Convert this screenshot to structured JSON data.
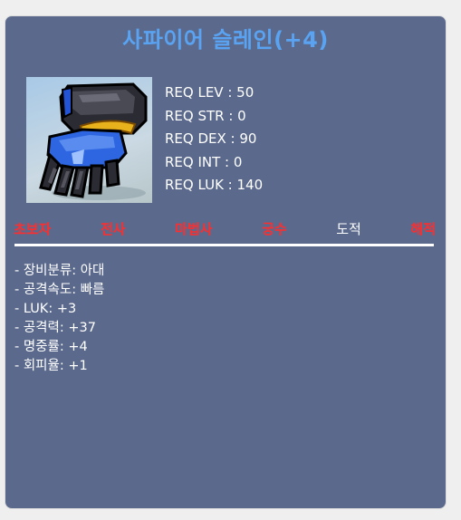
{
  "item": {
    "name": "사파이어 슬레인(+4)",
    "icon": "sapphire-slain-glove-icon"
  },
  "requirements": [
    "REQ LEV : 50",
    "REQ STR : 0",
    "REQ DEX : 90",
    "REQ INT : 0",
    "REQ LUK : 140"
  ],
  "jobs": [
    {
      "label": "초보자",
      "allowed": false
    },
    {
      "label": "전사",
      "allowed": false
    },
    {
      "label": "마법사",
      "allowed": false
    },
    {
      "label": "궁수",
      "allowed": false
    },
    {
      "label": "도적",
      "allowed": true
    },
    {
      "label": "해적",
      "allowed": false
    }
  ],
  "stats": [
    "- 장비분류: 아대",
    "- 공격속도: 빠름",
    "- LUK: +3",
    "- 공격력: +37",
    "- 명중률: +4",
    "- 회피율: +1"
  ],
  "colors": {
    "panel": "#5b6a8c",
    "title": "#59a3f2",
    "job_disallowed": "#ff2d2d",
    "job_allowed": "#ffffff",
    "text": "#ffffff"
  }
}
